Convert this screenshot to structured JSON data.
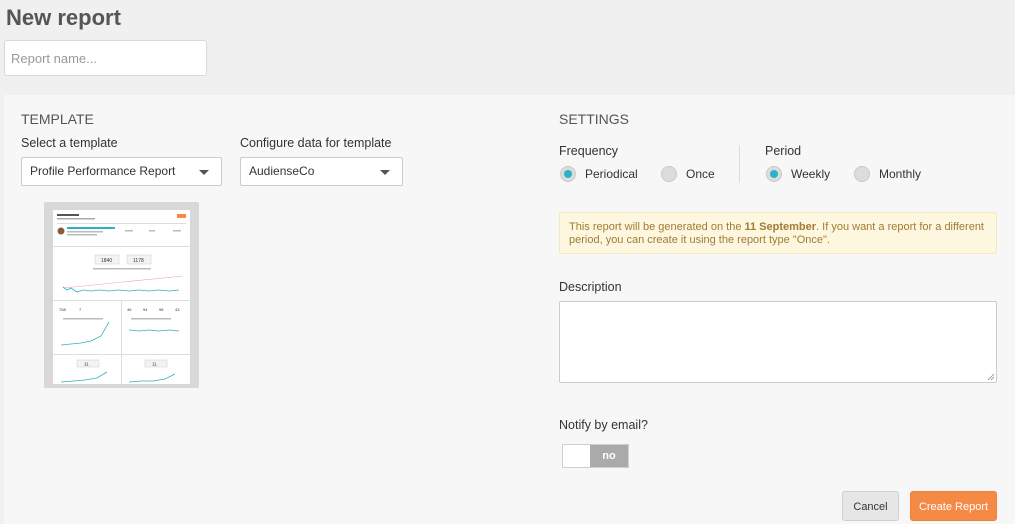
{
  "header": {
    "title": "New report",
    "name_placeholder": "Report name..."
  },
  "template": {
    "heading": "TEMPLATE",
    "select_label": "Select a template",
    "select_value": "Profile Performance Report",
    "configure_label": "Configure data for template",
    "configure_value": "AudienseCo"
  },
  "settings": {
    "heading": "SETTINGS",
    "frequency_label": "Frequency",
    "frequency_options": [
      {
        "label": "Periodical",
        "selected": true
      },
      {
        "label": "Once",
        "selected": false
      }
    ],
    "period_label": "Period",
    "period_options": [
      {
        "label": "Weekly",
        "selected": true
      },
      {
        "label": "Monthly",
        "selected": false
      }
    ],
    "notice_pre": "This report will be generated on the ",
    "notice_date": "11 September",
    "notice_post": ". If you want a report for a different period, you can create it using the report type \"Once\".",
    "description_label": "Description",
    "notify_label": "Notify by email?",
    "notify_state": "no"
  },
  "actions": {
    "cancel": "Cancel",
    "create": "Create Report"
  },
  "colors": {
    "accent": "#2bb3c5",
    "primary_button": "#f58a46",
    "notice_bg": "#fcf7de",
    "notice_text": "#a37a36"
  }
}
